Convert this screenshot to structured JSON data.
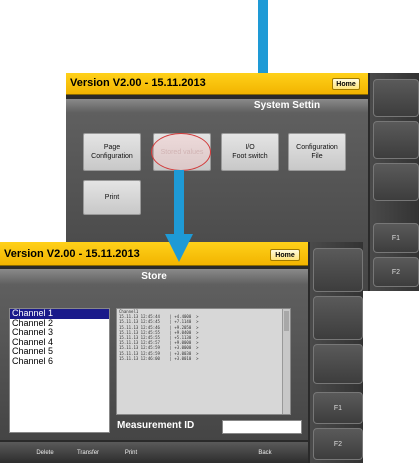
{
  "top_screen": {
    "version_text": "Version V2.00 - 15.11.2013",
    "home_label": "Home",
    "title": "System Settin",
    "tiles": {
      "page_configuration": "Page\nConfiguration",
      "stored_values": "Stored values",
      "io_foot_switch": "I/O\nFoot switch",
      "configuration_file": "Configuration\nFile",
      "print": "Print"
    },
    "side": {
      "f1": "F1",
      "f2": "F2"
    }
  },
  "bottom_screen": {
    "version_text": "Version V2.00 - 15.11.2013",
    "home_label": "Home",
    "title": "Store",
    "channels": [
      "Channel 1",
      "Channel 2",
      "Channel 3",
      "Channel 4",
      "Channel 5",
      "Channel 6"
    ],
    "selected_channel": "Channel 1",
    "data_header": "Channel1",
    "data_rows": [
      "15.11.13 12:45:44    | +4.4000  >",
      "15.11.13 12:45:45    | +7.1140  >",
      "15.11.13 12:45:46    | +9.2050  >",
      "15.11.13 12:45:55    | +9.0400  >",
      "15.11.13 12:45:55    | +5.1130  >",
      "15.11.13 12:45:57    | +9.0000  >",
      "15.11.13 12:45:59    | +3.0000  >",
      "15.11.13 12:45:59    | +3.0030  >",
      "15.11.13 12:46:00    | +3.0010  >"
    ],
    "measurement_label": "Measurement ID",
    "measurement_value": "",
    "bottom_buttons": {
      "delete": "Delete",
      "transfer": "Transfer",
      "print": "Print",
      "back": "Back"
    },
    "side": {
      "f1": "F1",
      "f2": "F2"
    }
  },
  "colors": {
    "arrow": "#1e9ad6",
    "yellow_bar": "#f2b400",
    "selection": "#1a1a8a",
    "highlight": "#d23a3a"
  }
}
